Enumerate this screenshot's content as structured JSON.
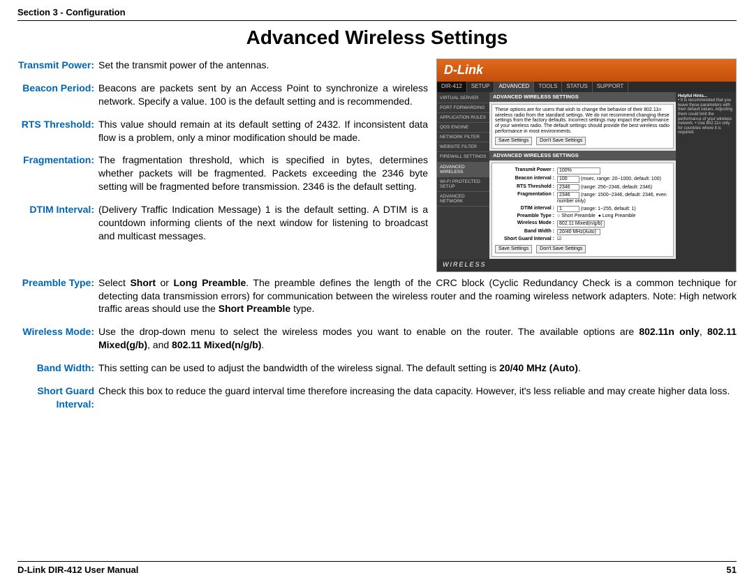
{
  "header": {
    "section": "Section 3 - Configuration"
  },
  "title": "Advanced Wireless Settings",
  "defs": {
    "transmit_power": {
      "label": "Transmit Power:",
      "text": "Set the transmit power of the antennas."
    },
    "beacon_period": {
      "label": "Beacon Period:",
      "text": "Beacons are packets sent by an Access Point to synchronize a wireless network. Specify a value. 100 is the default setting and is recommended."
    },
    "rts_threshold": {
      "label": "RTS Threshold:",
      "text": "This value should remain at its default setting of 2432. If inconsistent data flow is a problem, only a minor modification should be made."
    },
    "fragmentation": {
      "label": "Fragmentation:",
      "text": "The fragmentation threshold, which is specified in bytes, determines whether packets will be fragmented. Packets exceeding the 2346 byte setting will be fragmented before transmission. 2346 is the default setting."
    },
    "dtim_interval": {
      "label": "DTIM Interval:",
      "text": "(Delivery Traffic Indication Message) 1 is the default setting. A DTIM is a countdown informing clients of the next window for listening to broadcast and multicast messages."
    },
    "preamble_type": {
      "label": "Preamble Type:",
      "t1": "Select ",
      "b1": "Short",
      "t2": " or ",
      "b2": "Long Preamble",
      "t3": ". The preamble defines the length of the CRC block (Cyclic Redundancy Check is a common technique for detecting data transmission errors) for communication between the wireless router and the roaming wireless network adapters. Note: High network traffic areas should use the ",
      "b3": "Short Preamble",
      "t4": " type."
    },
    "wireless_mode": {
      "label": "Wireless Mode:",
      "t1": "Use the drop-down menu to select the wireless modes you want to enable on the router. The available options are ",
      "b1": "802.11n only",
      "t2": ", ",
      "b2": "802.11 Mixed(g/b)",
      "t3": ", and ",
      "b3": "802.11 Mixed(n/g/b)",
      "t4": "."
    },
    "band_width": {
      "label": "Band Width:",
      "t1": "This setting can be used to adjust the bandwidth of the wireless signal. The default setting is ",
      "b1": "20/40 MHz (Auto)",
      "t2": "."
    },
    "short_guard": {
      "label1": "Short Guard",
      "label2": "Interval:",
      "text": "Check this box to reduce the guard interval time therefore increasing the data capacity.  However, it's less reliable and may create higher data loss."
    }
  },
  "shot": {
    "brand": "D-Link",
    "device": "DIR-412",
    "nav": [
      "SETUP",
      "ADVANCED",
      "TOOLS",
      "STATUS",
      "SUPPORT"
    ],
    "side": [
      "VIRTUAL SERVER",
      "PORT FORWARDING",
      "APPLICATION RULES",
      "QOS ENGINE",
      "NETWORK FILTER",
      "WEBSITE FILTER",
      "FIREWALL SETTINGS",
      "ADVANCED WIRELESS",
      "WI-FI PROTECTED SETUP",
      "ADVANCED NETWORK"
    ],
    "hints_title": "Helpful Hints...",
    "hints_body": "• It is recommended that you leave these parameters with their default values. Adjusting them could limit the performance of your wireless network.\n• Use 802.11n only for countries where it is required.",
    "bar1": "ADVANCED WIRELESS SETTINGS",
    "intro": "These options are for users that wish to change the behavior of their 802.11n wireless radio from the standard settings. We do not recommend changing these settings from the factory defaults. Incorrect settings may impact the performance of your wireless radio. The default settings should provide the best wireless radio performance in most environments.",
    "btn_save": "Save Settings",
    "btn_dont": "Don't Save Settings",
    "bar2": "ADVANCED WIRELESS SETTINGS",
    "f": {
      "tp_l": "Transmit Power :",
      "tp_v": "100%",
      "bi_l": "Beacon interval :",
      "bi_v": "100",
      "bi_h": "(msec, range: 20~1000, default: 100)",
      "rts_l": "RTS Threshold :",
      "rts_v": "2346",
      "rts_h": "(range: 256~2346, default: 2346)",
      "fr_l": "Fragmentation :",
      "fr_v": "2346",
      "fr_h": "(range: 1500~2346, default: 2346, even number only)",
      "dt_l": "DTIM interval :",
      "dt_v": "1",
      "dt_h": "(range: 1~255, default: 1)",
      "pt_l": "Preamble Type :",
      "pt_s": "Short Preamble",
      "pt_lp": "Long Preamble",
      "wm_l": "Wireless Mode :",
      "wm_v": "802.11 Mixed(n/g/b)",
      "bw_l": "Band Width :",
      "bw_v": "20/40 MHz(Auto)",
      "sg_l": "Short Guard Interval :"
    },
    "footer": "WIRELESS"
  },
  "footer": {
    "manual": "D-Link DIR-412 User Manual",
    "page": "51"
  }
}
